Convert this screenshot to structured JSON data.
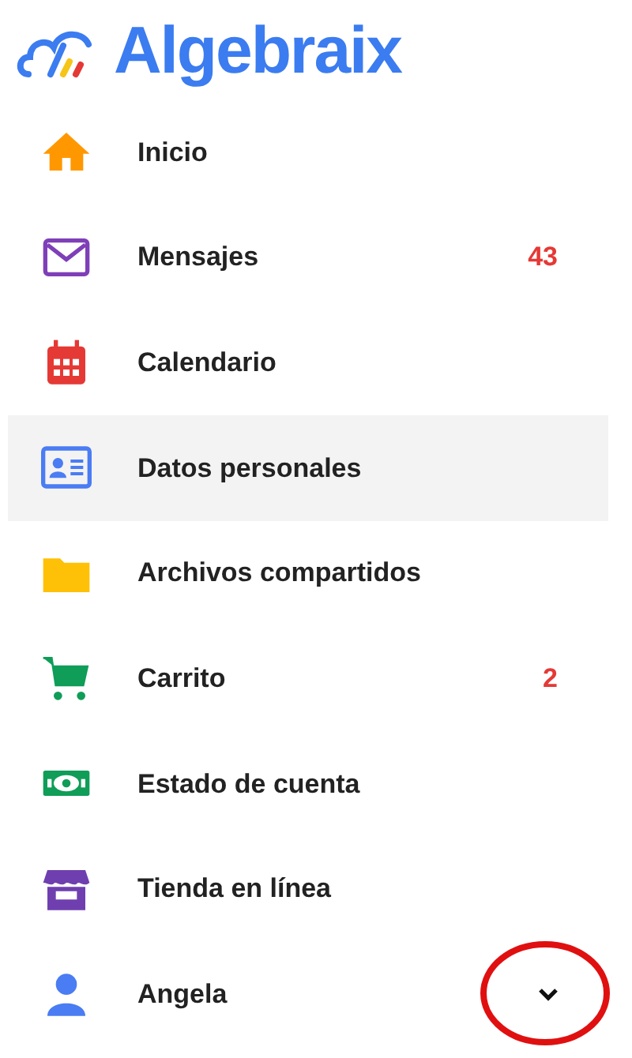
{
  "logo": {
    "text": "Algebraix"
  },
  "menu": [
    {
      "label": "Inicio",
      "color": "#ff9800",
      "selected": false
    },
    {
      "label": "Mensajes",
      "color": "#7e3fb8",
      "selected": false,
      "badge": "43"
    },
    {
      "label": "Calendario",
      "color": "#e53935",
      "selected": false
    },
    {
      "label": "Datos personales",
      "color": "#4a7cf3",
      "selected": true
    },
    {
      "label": "Archivos compartidos",
      "color": "#ffc107",
      "selected": false
    },
    {
      "label": "Carrito",
      "color": "#0f9d58",
      "selected": false,
      "badge": "2"
    },
    {
      "label": "Estado de cuenta",
      "color": "#0f9d58",
      "selected": false
    },
    {
      "label": "Tienda en línea",
      "color": "#6f3fb0",
      "selected": false
    },
    {
      "label": "Angela",
      "color": "#4a7cf3",
      "selected": false,
      "expanded": false
    }
  ]
}
